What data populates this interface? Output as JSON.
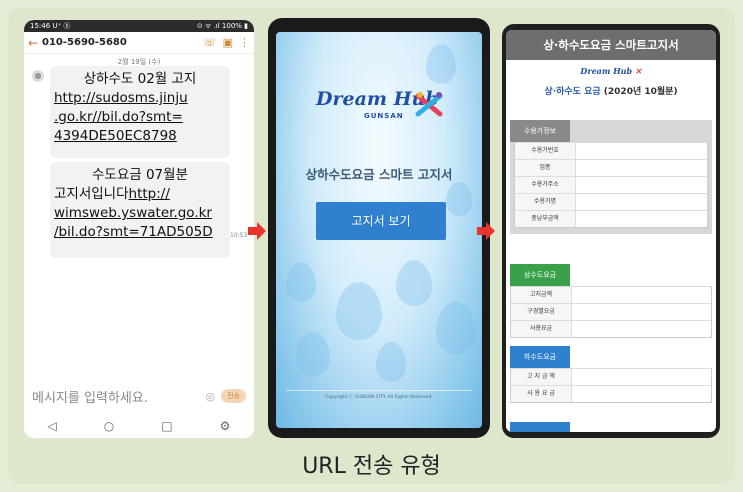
{
  "caption": "URL 전송 유형",
  "sms": {
    "status_left": "15:46 U⁺ ⓑ",
    "status_right": "⊙ ᯤ .ıl 100% ▮",
    "phone_number": "010-5690-5680",
    "date": "2월 19일 (수)",
    "message1": {
      "title": "상하수도 02월 고지",
      "link_lines": [
        "http://sudosms.jinju",
        ".go.kr//bil.do?smt=",
        "4394DE50EC8798"
      ]
    },
    "message2": {
      "title": "수도요금 07월분",
      "line2_text": "고지서입니다",
      "line2_link": "http://",
      "link_lines": [
        "wimsweb.yswater.go.kr",
        "/bil.do?smt=71AD505D"
      ]
    },
    "time": "10:53",
    "input_placeholder": "메시지를 입력하세요.",
    "send_label": "전송",
    "nav": [
      "◁",
      "○",
      "□",
      "⚙"
    ]
  },
  "splash": {
    "logo_text": "Dream Hub",
    "logo_sub": "GUNSAN",
    "title": "상하수도요금 스마트 고지서",
    "button_label": "고지서 보기",
    "copyright": "Copyright ⓒ GUNSAN CITY. All Rights Reserved."
  },
  "bill": {
    "header": "상·하수도요금 스마트고지서",
    "logo_text": "Dream Hub",
    "period_label": "상·하수도 요금",
    "period_value": "(2020년 10월분)",
    "section1": {
      "title": "수용가정보",
      "rows": [
        "수용가번호",
        "업종",
        "수용가주소",
        "수용가명",
        "총납부금액"
      ]
    },
    "section2": {
      "title": "상수도요금",
      "rows": [
        "고지금액",
        "구경별요금",
        "사용요금"
      ]
    },
    "section3": {
      "title": "하수도요금",
      "rows": [
        "고 지 금 액",
        "사 용 요 금"
      ]
    }
  },
  "colors": {
    "arrow": "#e8342f",
    "button_blue": "#2f80cf",
    "green": "#3aa14a",
    "gray_header": "#6e6e6e"
  }
}
